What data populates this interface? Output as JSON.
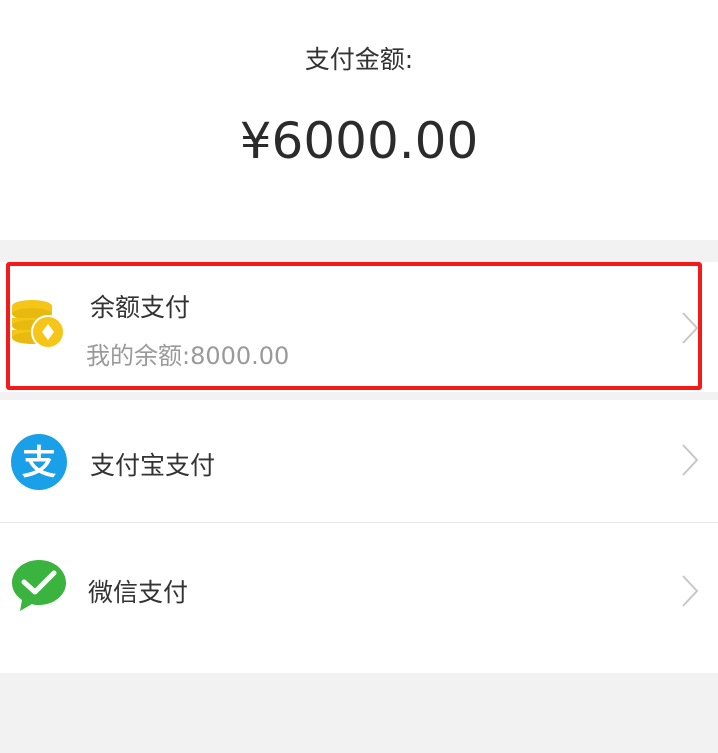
{
  "payment": {
    "amount_label": "支付金额:",
    "amount_value": "¥6000.00"
  },
  "methods": [
    {
      "title": "余额支付",
      "subtitle": "我的余额:8000.00",
      "icon": "coins-icon",
      "highlighted": true
    },
    {
      "title": "支付宝支付",
      "icon": "alipay-icon"
    },
    {
      "title": "微信支付",
      "icon": "wechat-pay-icon"
    }
  ],
  "colors": {
    "highlight": "#f51a1a",
    "alipay": "#1aa0e8",
    "wechat": "#3bb43f",
    "coin": "#f5c518"
  }
}
